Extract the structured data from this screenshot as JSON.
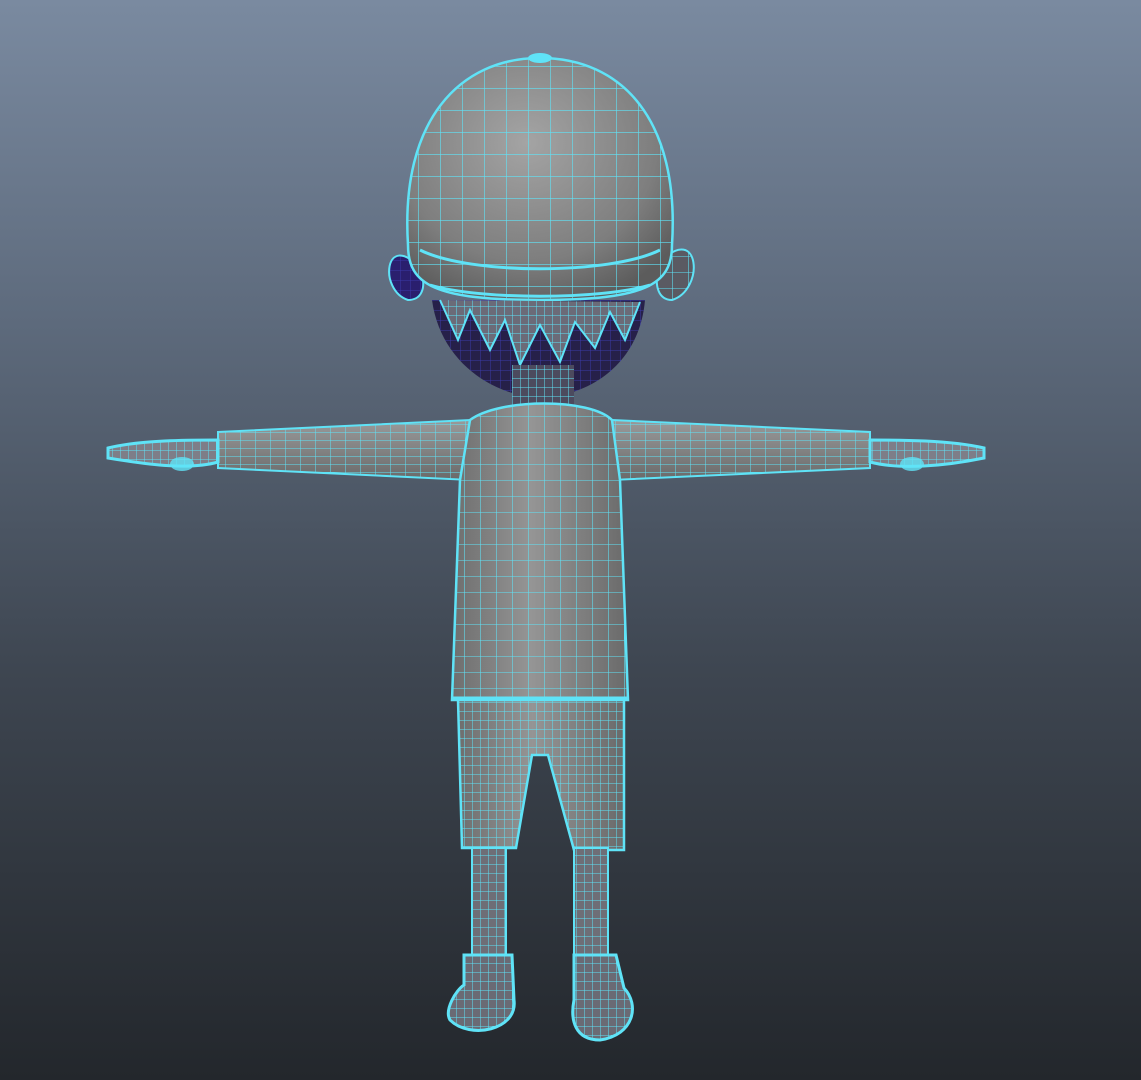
{
  "viewport": {
    "background_top": "#7a8aa0",
    "background_bottom": "#23272c"
  },
  "model": {
    "surface_color": "#8a8a8a",
    "wireframe_color": "#5fe3f7",
    "hair_color": "#2a1f6e",
    "selection_state": "selected"
  }
}
